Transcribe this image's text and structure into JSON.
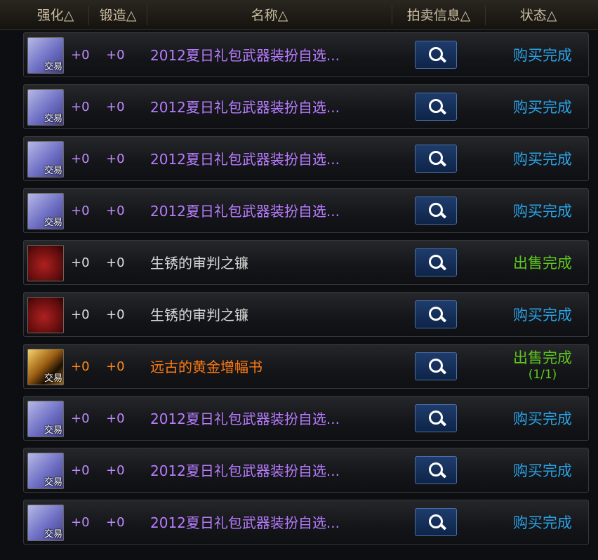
{
  "header": {
    "cols": [
      {
        "id": "qianghua",
        "label": "强化△"
      },
      {
        "id": "duanzao",
        "label": "锻造△"
      },
      {
        "id": "mingcheng",
        "label": "名称△"
      },
      {
        "id": "paimai",
        "label": "拍卖信息△"
      },
      {
        "id": "zhuangtai",
        "label": "状态△"
      }
    ]
  },
  "rows": [
    {
      "icon": "purple",
      "trade": "交易",
      "enhance": "+0",
      "forge": "+0",
      "name": "2012夏日礼包武器装扮自选...",
      "nameColor": "purple",
      "status": "购买完成",
      "statusColor": "blue"
    },
    {
      "icon": "purple",
      "trade": "交易",
      "enhance": "+0",
      "forge": "+0",
      "name": "2012夏日礼包武器装扮自选...",
      "nameColor": "purple",
      "status": "购买完成",
      "statusColor": "blue"
    },
    {
      "icon": "purple",
      "trade": "交易",
      "enhance": "+0",
      "forge": "+0",
      "name": "2012夏日礼包武器装扮自选...",
      "nameColor": "purple",
      "status": "购买完成",
      "statusColor": "blue"
    },
    {
      "icon": "purple",
      "trade": "交易",
      "enhance": "+0",
      "forge": "+0",
      "name": "2012夏日礼包武器装扮自选...",
      "nameColor": "purple",
      "status": "购买完成",
      "statusColor": "blue"
    },
    {
      "icon": "red",
      "trade": "",
      "enhance": "+0",
      "forge": "+0",
      "name": "生锈的审判之镰",
      "nameColor": "white",
      "status": "出售完成",
      "statusColor": "green"
    },
    {
      "icon": "red",
      "trade": "",
      "enhance": "+0",
      "forge": "+0",
      "name": "生锈的审判之镰",
      "nameColor": "white",
      "status": "购买完成",
      "statusColor": "blue"
    },
    {
      "icon": "gold",
      "trade": "交易",
      "enhance": "+0",
      "forge": "+0",
      "name": "远古的黄金增幅书",
      "nameColor": "orange",
      "status": "出售完成",
      "statusSub": "(1/1)",
      "statusColor": "green"
    },
    {
      "icon": "purple",
      "trade": "交易",
      "enhance": "+0",
      "forge": "+0",
      "name": "2012夏日礼包武器装扮自选...",
      "nameColor": "purple",
      "status": "购买完成",
      "statusColor": "blue"
    },
    {
      "icon": "purple",
      "trade": "交易",
      "enhance": "+0",
      "forge": "+0",
      "name": "2012夏日礼包武器装扮自选...",
      "nameColor": "purple",
      "status": "购买完成",
      "statusColor": "blue"
    },
    {
      "icon": "purple",
      "trade": "交易",
      "enhance": "+0",
      "forge": "+0",
      "name": "2012夏日礼包武器装扮自选...",
      "nameColor": "purple",
      "status": "购买完成",
      "statusColor": "blue"
    }
  ],
  "icons": {
    "search": "search-icon"
  }
}
